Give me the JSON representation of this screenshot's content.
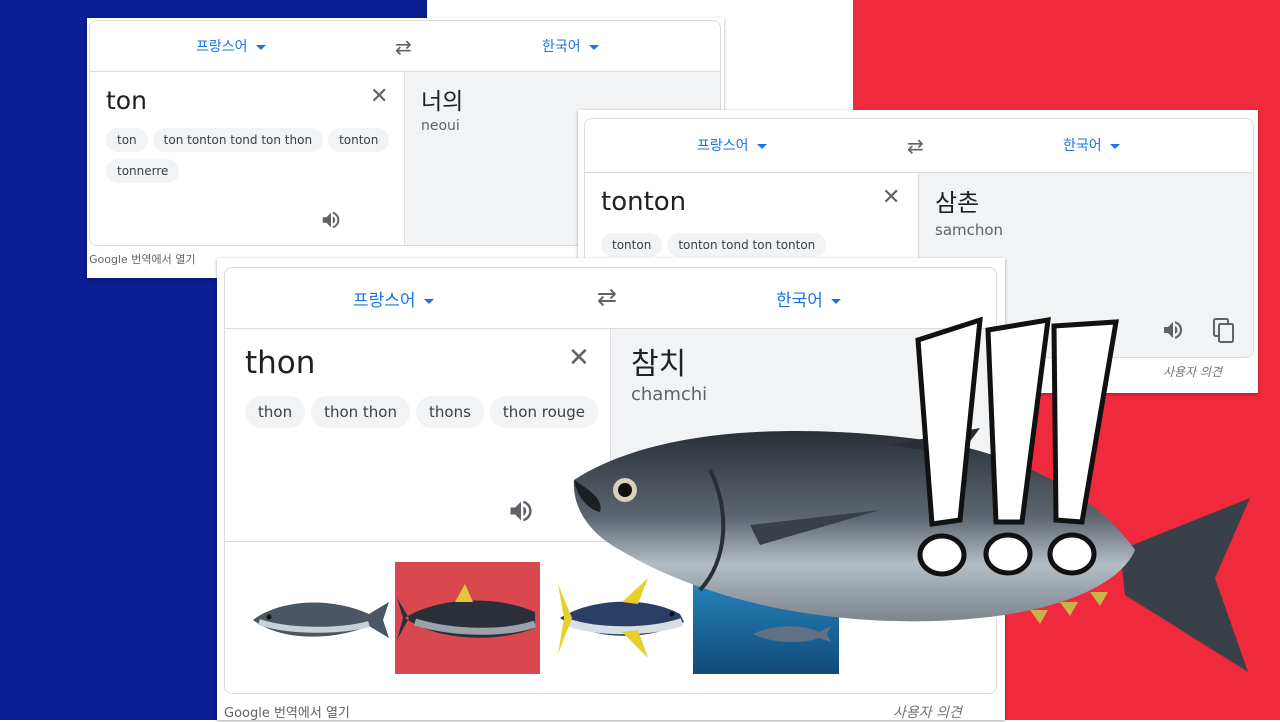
{
  "card_ton": {
    "source_lang": "프랑스어",
    "target_lang": "한국어",
    "source_text": "ton",
    "suggestions": [
      "ton",
      "ton tonton tond ton thon",
      "tonton",
      "tonnerre"
    ],
    "translation": "너의",
    "romanization": "neoui",
    "footer_left": "Google 번역에서 열기"
  },
  "card_tonton": {
    "source_lang": "프랑스어",
    "target_lang": "한국어",
    "source_text": "tonton",
    "suggestions": [
      "tonton",
      "tonton tond ton tonton"
    ],
    "translation": "삼촌",
    "romanization": "samchon",
    "footer_right": "사용자 의견"
  },
  "card_thon": {
    "source_lang": "프랑스어",
    "target_lang": "한국어",
    "source_text": "thon",
    "suggestions": [
      "thon",
      "thon thon",
      "thons",
      "thon rouge"
    ],
    "translation": "참치",
    "romanization": "chamchi",
    "footer_left": "Google 번역에서 열기",
    "footer_right": "사용자 의견"
  },
  "colors": {
    "flag_blue": "#0a1f91",
    "flag_white": "#ffffff",
    "flag_red": "#ee2a3c",
    "link_blue": "#1a73e8"
  }
}
